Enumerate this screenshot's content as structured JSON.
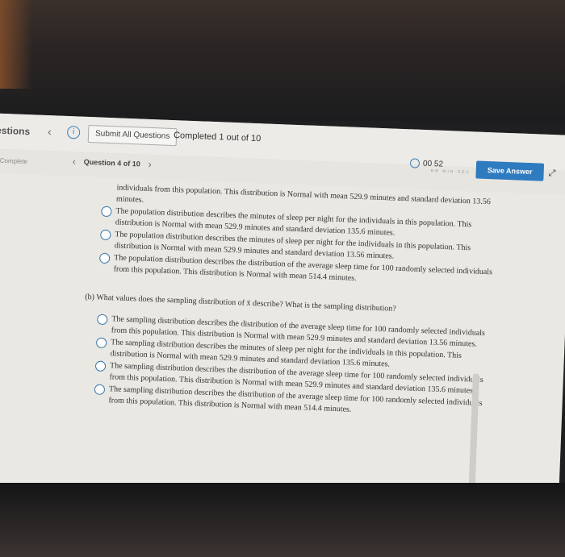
{
  "top": {
    "questions": "estions",
    "submit_all": "Submit All Questions",
    "completed": "Completed 1 out of 10"
  },
  "sub": {
    "complete_small": "Complete",
    "question_label": "Question 4 of 10",
    "timer": "00 52",
    "timer_units": "HR MIN SEC",
    "save": "Save Answer"
  },
  "part_a": {
    "continuation": "individuals from this population. This distribution is Normal with mean 529.9 minutes and standard deviation 13.56 minutes.",
    "options": [
      "The population distribution describes the minutes of sleep per night for the individuals in this population. This distribution is Normal with mean 529.9 minutes and standard deviation 135.6 minutes.",
      "The population distribution describes the minutes of sleep per night for the individuals in this population. This distribution is Normal with mean 529.9 minutes and standard deviation 13.56 minutes.",
      "The population distribution describes the distribution of the average sleep time for 100 randomly selected individuals from this population. This distribution is Normal with mean 514.4 minutes."
    ]
  },
  "part_b": {
    "question": "(b) What values does the sampling distribution of x̄ describe? What is the sampling distribution?",
    "options": [
      "The sampling distribution describes the distribution of the average sleep time for 100 randomly selected individuals from this population. This distribution is Normal with mean 529.9 minutes and standard deviation 13.56 minutes.",
      "The sampling distribution describes the minutes of sleep per night for the individuals in this population. This distribution is Normal with mean 529.9 minutes and standard deviation 135.6 minutes.",
      "The sampling distribution describes the distribution of the average sleep time for 100 randomly selected individuals from this population. This distribution is Normal with mean 529.9 minutes and standard deviation 135.6 minutes.",
      "The sampling distribution describes the distribution of the average sleep time for 100 randomly selected individuals from this population. This distribution is Normal with mean 514.4 minutes."
    ]
  },
  "icons": {
    "back": "chevron-left-icon",
    "forward": "chevron-right-icon",
    "info": "info-icon",
    "timer": "clock-icon",
    "expand": "expand-icon"
  },
  "colors": {
    "accent": "#2f7bbf",
    "screen_bg": "#e9e8e3"
  }
}
